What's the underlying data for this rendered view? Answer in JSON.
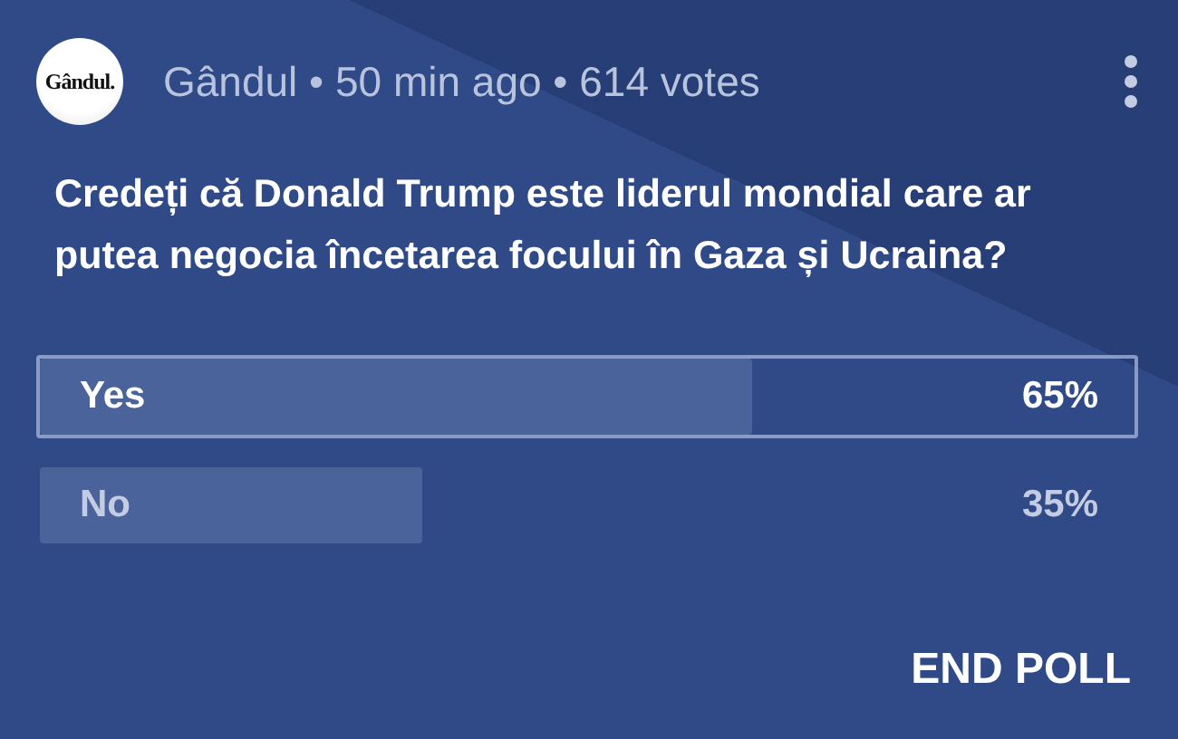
{
  "header": {
    "logo": "Gândul.",
    "meta": "Gândul • 50 min ago • 614 votes"
  },
  "question": "Credeți că Donald Trump este liderul mondial care ar putea negocia încetarea focului în Gaza și Ucraina?",
  "options": [
    {
      "label": "Yes",
      "percent": "65%",
      "level": 0.65,
      "selected": true
    },
    {
      "label": "No",
      "percent": "35%",
      "level": 0.35,
      "selected": false
    }
  ],
  "action": "END POLL"
}
